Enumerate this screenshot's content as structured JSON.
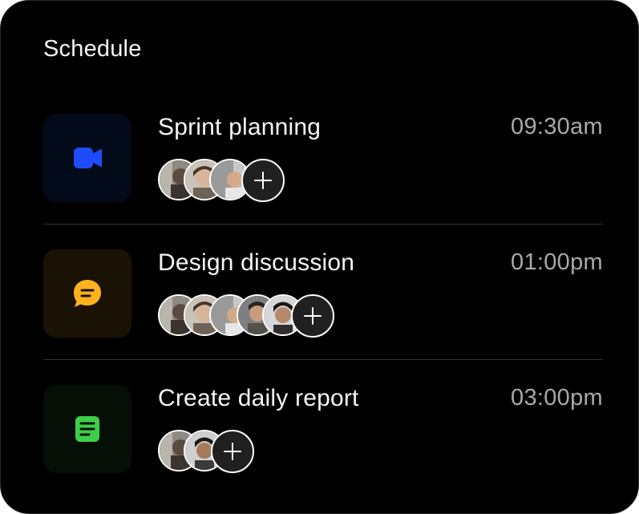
{
  "card": {
    "title": "Schedule"
  },
  "events": [
    {
      "title": "Sprint planning",
      "time": "09:30am",
      "icon": "video-camera-icon",
      "accent": "#1f4bff",
      "tile_bg": "#030a1a",
      "participants": [
        "avatar-1",
        "avatar-2",
        "avatar-3"
      ]
    },
    {
      "title": "Design discussion",
      "time": "01:00pm",
      "icon": "chat-bubble-icon",
      "accent": "#ffb21f",
      "tile_bg": "#1b1206",
      "participants": [
        "avatar-1",
        "avatar-2",
        "avatar-3",
        "avatar-4",
        "avatar-5"
      ]
    },
    {
      "title": "Create daily report",
      "time": "03:00pm",
      "icon": "document-icon",
      "accent": "#3ecf4a",
      "tile_bg": "#050f06",
      "participants": [
        "avatar-1",
        "avatar-2"
      ]
    }
  ],
  "add_participant_icon": "plus-icon"
}
